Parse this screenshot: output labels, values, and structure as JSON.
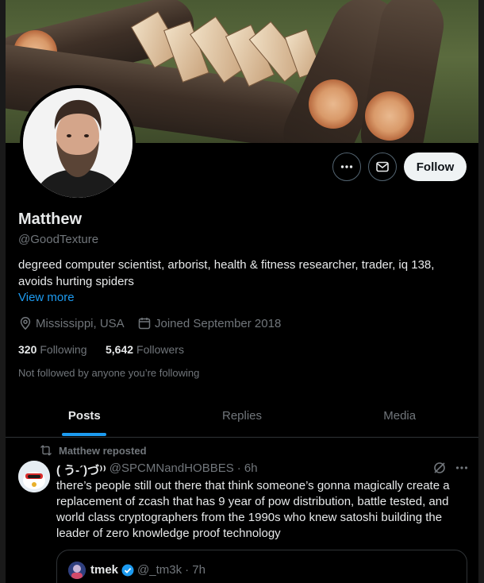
{
  "profile": {
    "name": "Matthew",
    "handle": "@GoodTexture",
    "bio": "degreed computer scientist, arborist, health & fitness researcher, trader, iq 138, avoids hurting spiders",
    "view_more": "View more",
    "location": "Mississippi, USA",
    "joined": "Joined September 2018",
    "following_count": "320",
    "following_label": "Following",
    "followers_count": "5,642",
    "followers_label": "Followers",
    "not_followed": "Not followed by anyone you’re following"
  },
  "actions": {
    "more_icon": "more-icon",
    "message_icon": "mail-icon",
    "follow_label": "Follow"
  },
  "tabs": [
    {
      "label": "Posts"
    },
    {
      "label": "Replies"
    },
    {
      "label": "Media"
    }
  ],
  "post": {
    "repost_label": "Matthew reposted",
    "author_name": "( う-´)づ︎⁾⁾",
    "author_handle": "@SPCMNandHOBBES",
    "time": "· 6h",
    "text": "there’s people still out there that think someone’s gonna magically create a replacement of zcash that has 9 year of pow distribution, battle tested, and world class cryptographers from the 1990s who knew satoshi building the leader of zero knowledge proof technology",
    "quote": {
      "name": "tmek",
      "handle": "@_tm3k",
      "time": "· 7h"
    }
  },
  "colors": {
    "accent": "#1d9bf0",
    "text": "#e7e9ea",
    "muted": "#71767b",
    "border": "#2f3336",
    "background": "#000000"
  }
}
